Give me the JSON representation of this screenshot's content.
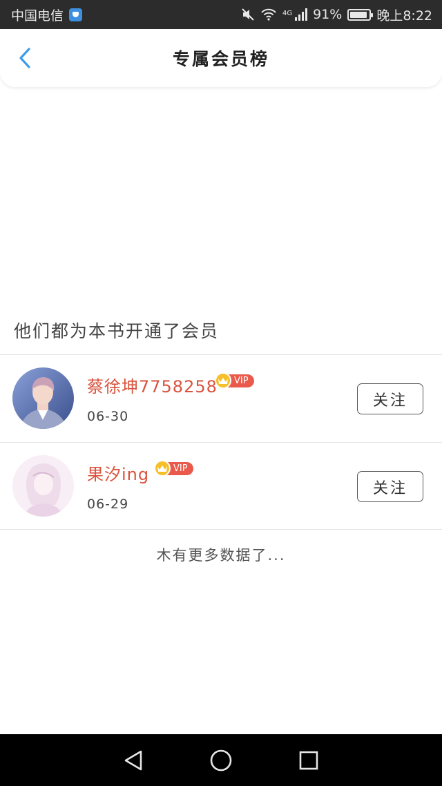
{
  "status_bar": {
    "carrier": "中国电信",
    "network": "4G",
    "battery": "91%",
    "time": "晚上8:22"
  },
  "header": {
    "title": "专属会员榜"
  },
  "section_label": "他们都为本书开通了会员",
  "members": [
    {
      "name": "蔡徐坤7758258",
      "badge": "VIP",
      "date": "06-30",
      "follow_label": "关注"
    },
    {
      "name": "果汐ing",
      "badge": "VIP",
      "date": "06-29",
      "follow_label": "关注"
    }
  ],
  "no_more_text": "木有更多数据了...",
  "colors": {
    "accent_back": "#3d9be9",
    "member_name": "#d9533d",
    "vip_badge": "#ea5a4c",
    "crown": "#f6c02a"
  },
  "icons": {
    "back": "chevron-left-icon",
    "mute": "mute-icon",
    "wifi": "wifi-icon",
    "signal": "signal-icon",
    "battery": "battery-icon",
    "crown": "crown-icon",
    "nav_back": "nav-back-icon",
    "nav_home": "nav-home-icon",
    "nav_recent": "nav-recent-icon"
  }
}
